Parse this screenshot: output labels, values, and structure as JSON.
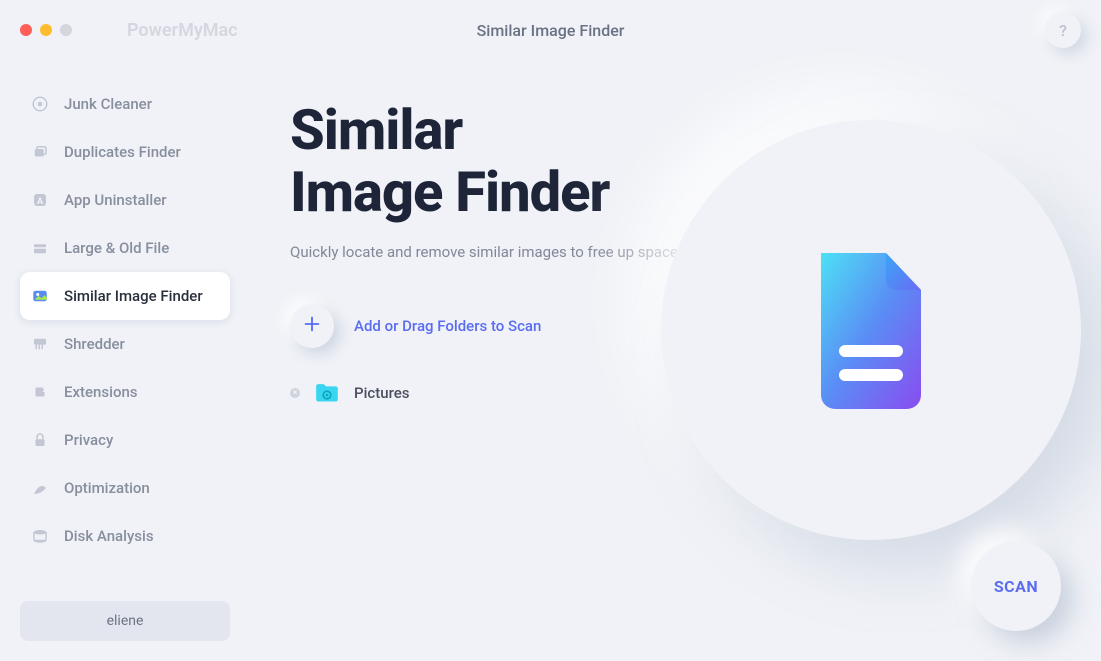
{
  "app_name": "PowerMyMac",
  "title": "Similar Image Finder",
  "help_label": "?",
  "sidebar": {
    "items": [
      {
        "label": "Junk Cleaner",
        "icon": "junk-icon"
      },
      {
        "label": "Duplicates Finder",
        "icon": "duplicates-icon"
      },
      {
        "label": "App Uninstaller",
        "icon": "uninstaller-icon"
      },
      {
        "label": "Large & Old File",
        "icon": "large-file-icon"
      },
      {
        "label": "Similar Image Finder",
        "icon": "image-finder-icon",
        "active": true
      },
      {
        "label": "Shredder",
        "icon": "shredder-icon"
      },
      {
        "label": "Extensions",
        "icon": "extensions-icon"
      },
      {
        "label": "Privacy",
        "icon": "privacy-icon"
      },
      {
        "label": "Optimization",
        "icon": "optimization-icon"
      },
      {
        "label": "Disk Analysis",
        "icon": "disk-icon"
      }
    ],
    "user": "eliene"
  },
  "main": {
    "heading_line1": "Similar",
    "heading_line2": "Image Finder",
    "subtitle": "Quickly locate and remove similar images to free up space.",
    "add_label": "Add or Drag Folders to Scan",
    "folders": [
      {
        "name": "Pictures"
      }
    ],
    "scan_label": "SCAN"
  },
  "colors": {
    "accent": "#5a6cf0",
    "heading": "#1f2538"
  }
}
